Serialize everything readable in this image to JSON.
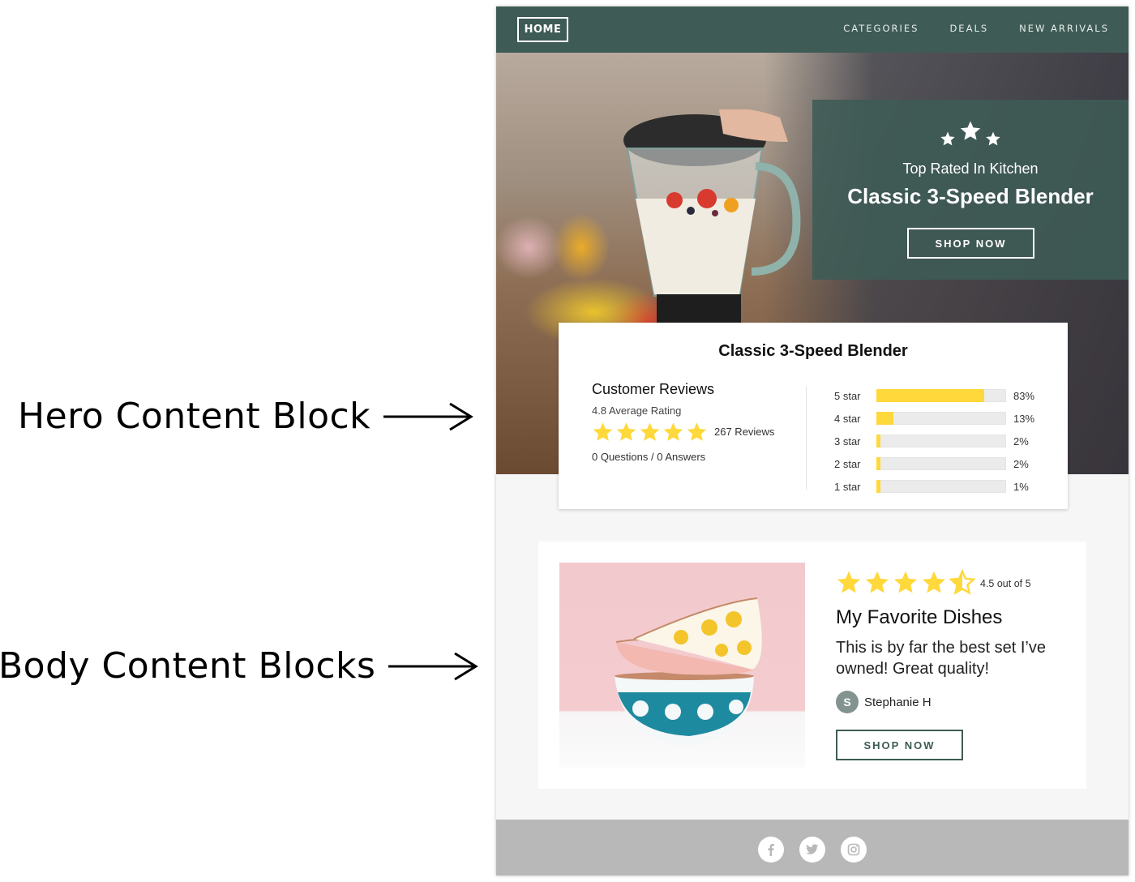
{
  "annotations": {
    "hero_label": "Hero Content Block",
    "body_label": "Body Content Blocks"
  },
  "nav": {
    "home_label": "HOME",
    "links": [
      {
        "label": "CATEGORIES"
      },
      {
        "label": "DEALS"
      },
      {
        "label": "NEW ARRIVALS"
      }
    ]
  },
  "hero": {
    "subtitle": "Top Rated In Kitchen",
    "title": "Classic 3-Speed Blender",
    "cta_label": "SHOP NOW",
    "icon": "three-stars-icon"
  },
  "reviews": {
    "product_title": "Classic 3-Speed Blender",
    "heading": "Customer Reviews",
    "average_text": "4.8 Average Rating",
    "average_rating": 4.8,
    "stars_shown": 5,
    "review_count": "267 Reviews",
    "qa_text": "0 Questions / 0 Answers",
    "breakdown": [
      {
        "label": "5 star",
        "percent": 83,
        "percent_text": "83%"
      },
      {
        "label": "4 star",
        "percent": 13,
        "percent_text": "13%"
      },
      {
        "label": "3 star",
        "percent": 2,
        "percent_text": "2%"
      },
      {
        "label": "2 star",
        "percent": 2,
        "percent_text": "2%"
      },
      {
        "label": "1 star",
        "percent": 1,
        "percent_text": "1%"
      }
    ],
    "star_color": "#ffd83b"
  },
  "body_block": {
    "rating": 4.5,
    "rating_text": "4.5 out of 5",
    "title": "My Favorite Dishes",
    "quote": "This is by far the best set I’ve owned! Great quality!",
    "author_initial": "S",
    "author_name": "Stephanie H",
    "cta_label": "SHOP NOW"
  },
  "footer": {
    "social": [
      {
        "name": "facebook-icon"
      },
      {
        "name": "twitter-icon"
      },
      {
        "name": "instagram-icon"
      }
    ]
  },
  "colors": {
    "brand": "#3e5b55",
    "star": "#ffd83b",
    "footer": "#b8b8b8",
    "page_bg": "#f6f6f6"
  }
}
